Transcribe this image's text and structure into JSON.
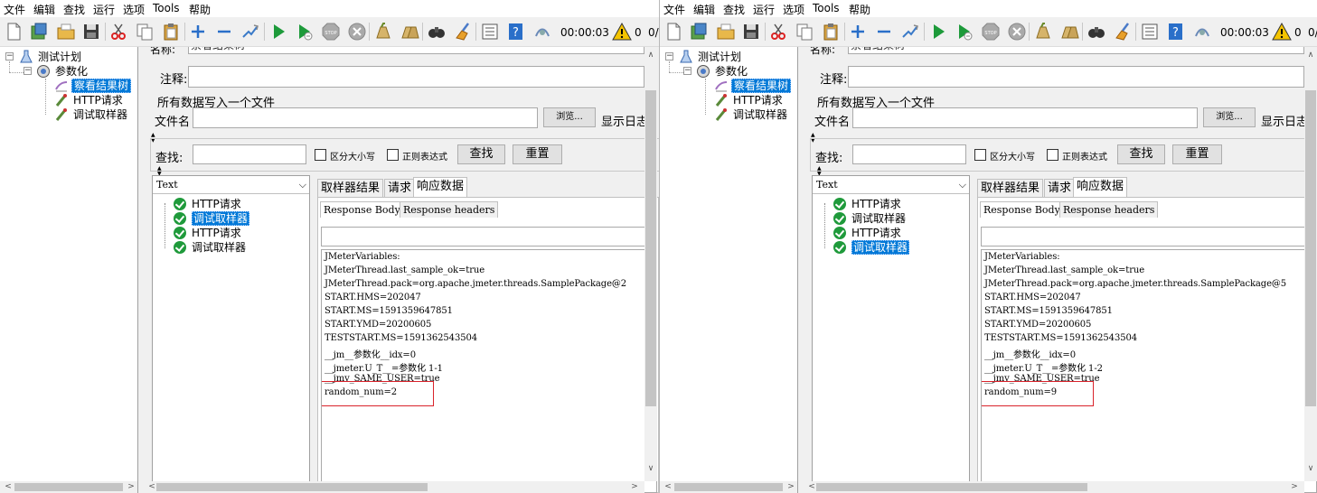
{
  "windows": [
    {
      "menu": [
        "文件",
        "编辑",
        "查找",
        "运行",
        "选项",
        "Tools",
        "帮助"
      ],
      "toolbar": {
        "timer": "00:00:03",
        "error_count": "0",
        "thread_count": "0/"
      },
      "tree": {
        "root": "测试计划",
        "group": "参数化",
        "listener": "察看结果树",
        "sampler1": "HTTP请求",
        "sampler2": "调试取样器"
      },
      "form": {
        "name_label": "名称:",
        "name_value": "察看结果树",
        "comment_label": "注释:",
        "file_section": "所有数据写入一个文件",
        "filename_label": "文件名",
        "browse_button": "浏览...",
        "log_label": "显示日志",
        "search_label": "查找:",
        "case_label": "区分大小写",
        "regex_label": "正则表达式",
        "find_button": "查找",
        "reset_button": "重置"
      },
      "results": {
        "renderer": "Text",
        "items": [
          "HTTP请求",
          "调试取样器",
          "HTTP请求",
          "调试取样器"
        ],
        "selected_index": 1
      },
      "tabs": [
        "取样器结果",
        "请求",
        "响应数据"
      ],
      "subtabs": [
        "Response Body",
        "Response headers"
      ],
      "body_lines": [
        "JMeterVariables:",
        "JMeterThread.last_sample_ok=true",
        "JMeterThread.pack=org.apache.jmeter.threads.SamplePackage@2",
        "START.HMS=202047",
        "START.MS=1591359647851",
        "START.YMD=20200605",
        "TESTSTART.MS=1591362543504",
        "__jm__参数化__idx=0",
        "__jmeter.U_T__=参数化 1-1",
        "__jmv_SAME_USER=true",
        "random_num=2"
      ]
    },
    {
      "menu": [
        "文件",
        "编辑",
        "查找",
        "运行",
        "选项",
        "Tools",
        "帮助"
      ],
      "toolbar": {
        "timer": "00:00:03",
        "error_count": "0",
        "thread_count": "0/"
      },
      "tree": {
        "root": "测试计划",
        "group": "参数化",
        "listener": "察看结果树",
        "sampler1": "HTTP请求",
        "sampler2": "调试取样器"
      },
      "form": {
        "name_label": "名称:",
        "name_value": "察看结果树",
        "comment_label": "注释:",
        "file_section": "所有数据写入一个文件",
        "filename_label": "文件名",
        "browse_button": "浏览...",
        "log_label": "显示日志",
        "search_label": "查找:",
        "case_label": "区分大小写",
        "regex_label": "正则表达式",
        "find_button": "查找",
        "reset_button": "重置"
      },
      "results": {
        "renderer": "Text",
        "items": [
          "HTTP请求",
          "调试取样器",
          "HTTP请求",
          "调试取样器"
        ],
        "selected_index": 3
      },
      "tabs": [
        "取样器结果",
        "请求",
        "响应数据"
      ],
      "subtabs": [
        "Response Body",
        "Response headers"
      ],
      "body_lines": [
        "JMeterVariables:",
        "JMeterThread.last_sample_ok=true",
        "JMeterThread.pack=org.apache.jmeter.threads.SamplePackage@5",
        "START.HMS=202047",
        "START.MS=1591359647851",
        "START.YMD=20200605",
        "TESTSTART.MS=1591362543504",
        "__jm__参数化__idx=0",
        "__jmeter.U_T__=参数化 1-2",
        "__jmv_SAME_USER=true",
        "random_num=9"
      ]
    }
  ]
}
